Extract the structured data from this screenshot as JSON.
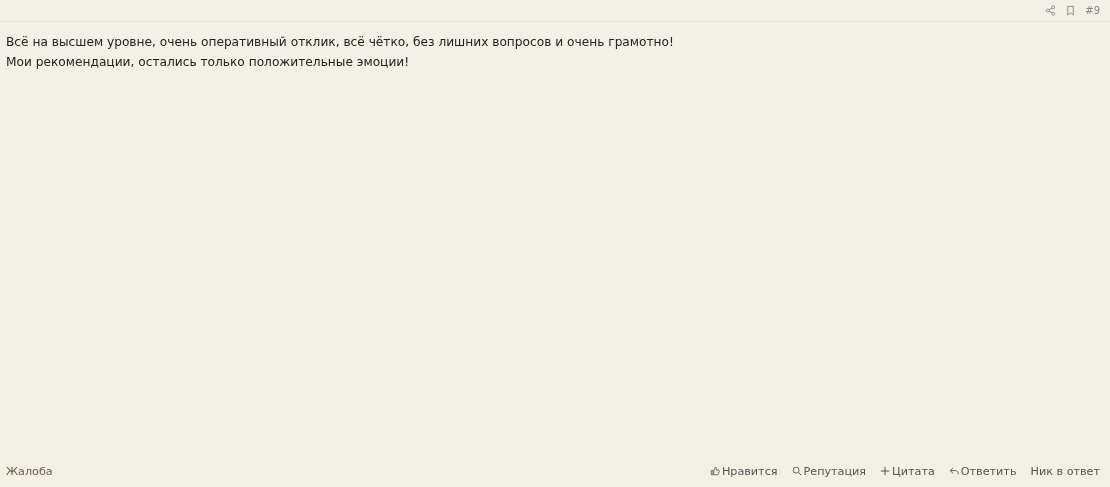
{
  "post_number": "#9",
  "body": [
    "Всё на высшем уровне, очень оперативный отклик, всё чётко, без лишних вопросов и очень грамотно!",
    "Мои рекомендации, остались только положительные эмоции!"
  ],
  "report_link": "Жалоба",
  "actions": [
    {
      "kind": "like",
      "label": "Нравится"
    },
    {
      "kind": "reputation",
      "label": "Репутация"
    },
    {
      "kind": "quote",
      "label": "Цитата"
    },
    {
      "kind": "reply",
      "label": "Ответить"
    },
    {
      "kind": "nick",
      "label": "Ник в ответ"
    }
  ]
}
